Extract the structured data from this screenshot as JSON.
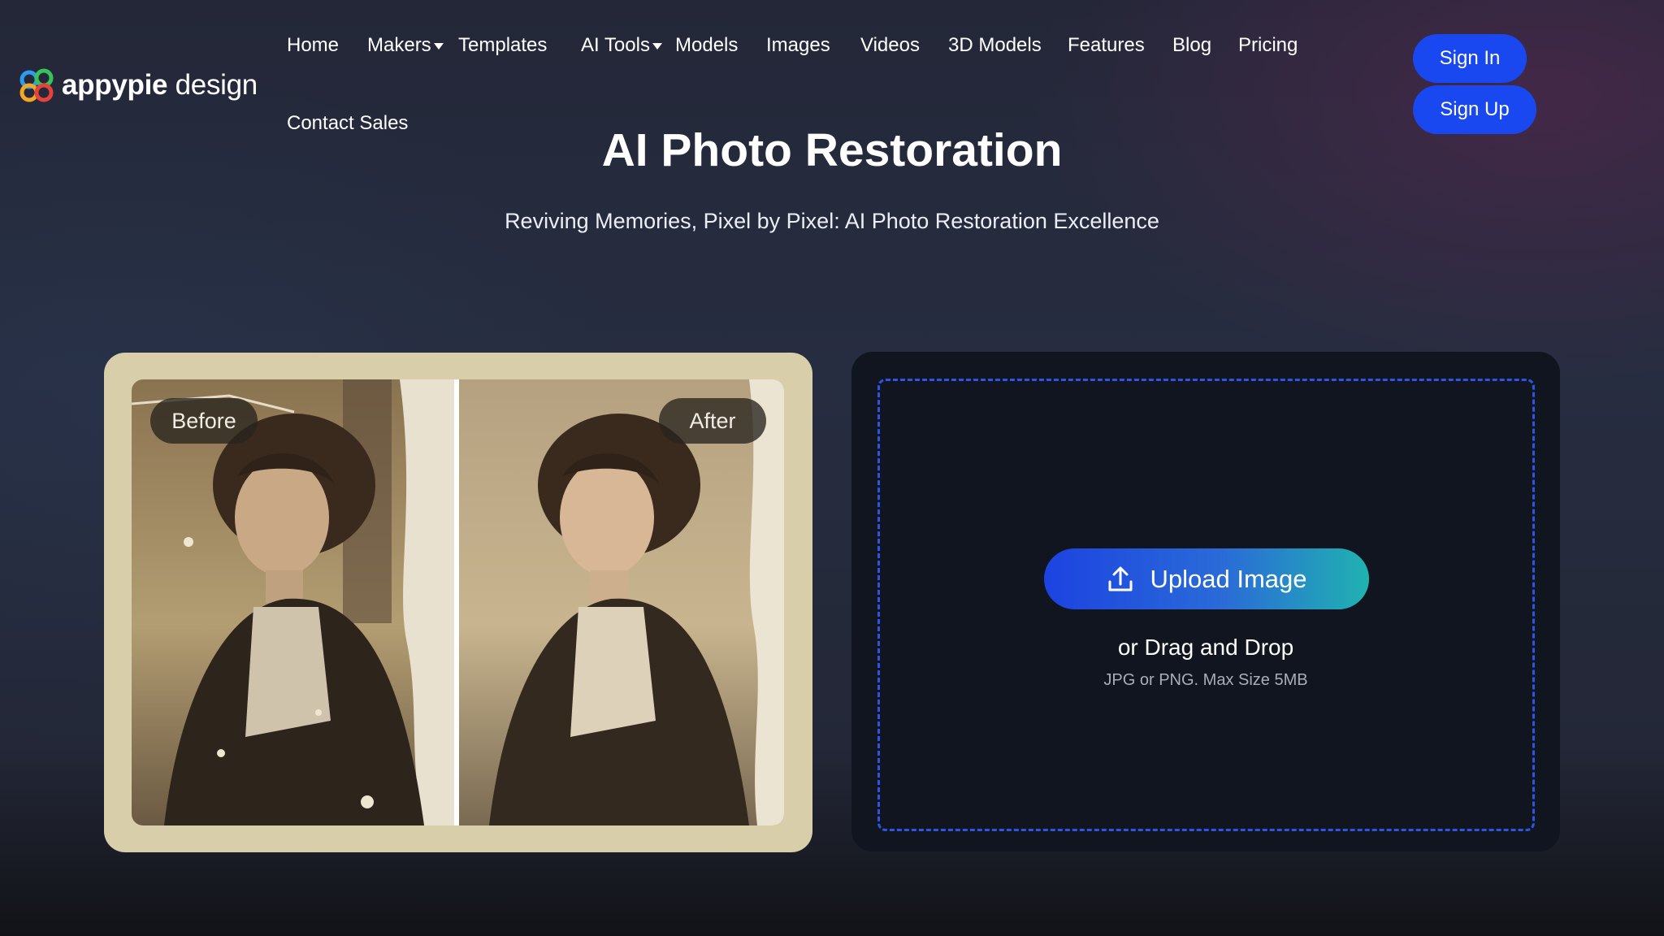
{
  "header": {
    "logo": {
      "brand": "appypie",
      "suffix": "design",
      "icon": "appypie-logo-icon"
    },
    "nav": [
      {
        "label": "Home",
        "dropdown": false
      },
      {
        "label": "Makers",
        "dropdown": true
      },
      {
        "label": "Templates",
        "dropdown": false
      },
      {
        "label": "AI Tools",
        "dropdown": true
      },
      {
        "label": "Models",
        "dropdown": false
      },
      {
        "label": "Images",
        "dropdown": false
      },
      {
        "label": "Videos",
        "dropdown": false
      },
      {
        "label": "3D Models",
        "dropdown": false
      },
      {
        "label": "Features",
        "dropdown": false
      },
      {
        "label": "Blog",
        "dropdown": false
      },
      {
        "label": "Pricing",
        "dropdown": false
      },
      {
        "label": "Contact Sales",
        "dropdown": false
      }
    ],
    "sign_in": "Sign In",
    "sign_up": "Sign Up"
  },
  "hero": {
    "title": "AI Photo Restoration",
    "subtitle": "Reviving Memories, Pixel by Pixel: AI Photo Restoration Excellence"
  },
  "comparison": {
    "before_label": "Before",
    "after_label": "After"
  },
  "upload": {
    "button_label": "Upload Image",
    "icon": "upload-icon",
    "drag_text": "or Drag and Drop",
    "hint": "JPG or PNG. Max Size 5MB"
  },
  "colors": {
    "accent_blue": "#1a48f0",
    "gradient_end": "#20b2b0",
    "dashed_border": "#2c55e8",
    "frame": "#d8cfaa"
  }
}
